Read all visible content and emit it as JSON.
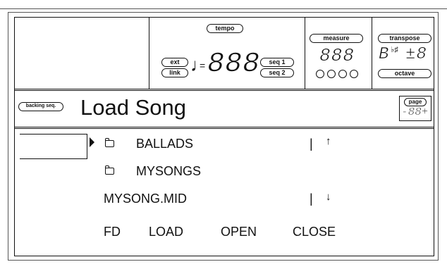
{
  "header": {
    "tempo_label": "tempo",
    "ext_label": "ext",
    "link_label": "link",
    "seq1_label": "seq 1",
    "seq2_label": "seq 2",
    "tempo_value": "888",
    "note_symbol": "♩",
    "equals_sign": "=",
    "measure_label": "measure",
    "measure_value": "888",
    "transpose_label": "transpose",
    "transpose_note": "B",
    "flat_sharp": "♭♯",
    "transpose_value": "±8",
    "octave_label": "octave"
  },
  "title_bar": {
    "mode_label": "backing seq.",
    "title": "Load Song",
    "page_label": "page",
    "page_value": "-88+"
  },
  "file_list": {
    "items": [
      {
        "name": "BALLADS",
        "is_folder": true
      },
      {
        "name": "MYSONGS",
        "is_folder": true
      },
      {
        "name": "MYSONG.MID",
        "is_folder": false
      }
    ],
    "scroll_up": "↑",
    "scroll_down": "↓",
    "scroll_separator": "|"
  },
  "buttons": {
    "fd": "FD",
    "load": "LOAD",
    "open": "OPEN",
    "close": "CLOSE"
  }
}
